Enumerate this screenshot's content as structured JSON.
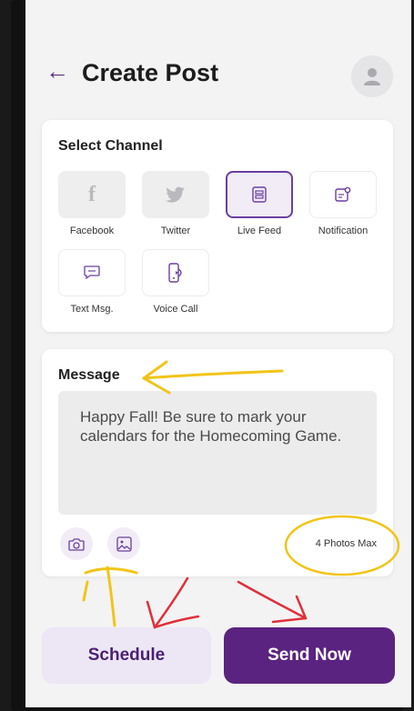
{
  "header": {
    "title": "Create Post",
    "back_icon": "arrow-left-icon",
    "avatar_icon": "user-icon"
  },
  "channels": {
    "title": "Select Channel",
    "items": [
      {
        "label": "Facebook",
        "icon": "facebook-icon",
        "state": "disabled"
      },
      {
        "label": "Twitter",
        "icon": "twitter-icon",
        "state": "disabled"
      },
      {
        "label": "Live Feed",
        "icon": "live-feed-icon",
        "state": "selected"
      },
      {
        "label": "Notification",
        "icon": "notification-icon",
        "state": "default"
      },
      {
        "label": "Text Msg.",
        "icon": "chat-icon",
        "state": "default"
      },
      {
        "label": "Voice Call",
        "icon": "phone-icon",
        "state": "default"
      }
    ]
  },
  "message": {
    "title": "Message",
    "text": "Happy Fall! Be sure to mark your calendars for the Homecoming Game.",
    "camera_icon": "camera-icon",
    "gallery_icon": "image-icon",
    "photos_max": "4 Photos Max"
  },
  "actions": {
    "schedule_label": "Schedule",
    "send_label": "Send Now"
  },
  "colors": {
    "accent": "#5a2380",
    "accent_light": "#ece6f5",
    "annotation_yellow": "#f2c418",
    "annotation_red": "#e0303a"
  }
}
